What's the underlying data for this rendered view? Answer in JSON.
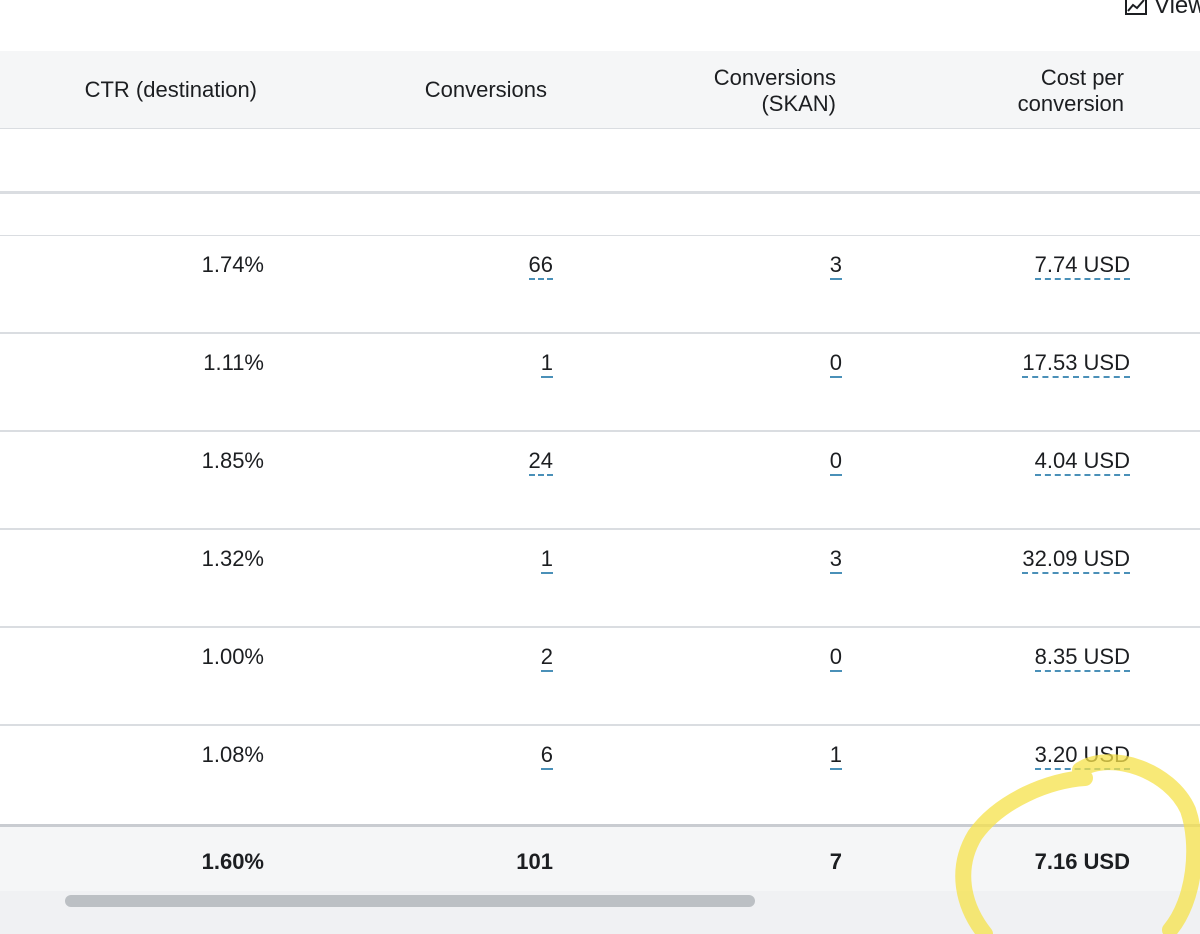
{
  "top": {
    "view_label": "View"
  },
  "headers": {
    "ctr": "CTR (destination)",
    "conversions": "Conversions",
    "skan_line1": "Conversions",
    "skan_line2": "(SKAN)",
    "cost_line1": "Cost per",
    "cost_line2": "conversion"
  },
  "rows": [
    {
      "ctr": "1.74%",
      "conversions": "66",
      "skan": "3",
      "cost": "7.74 USD"
    },
    {
      "ctr": "1.11%",
      "conversions": "1",
      "skan": "0",
      "cost": "17.53 USD"
    },
    {
      "ctr": "1.85%",
      "conversions": "24",
      "skan": "0",
      "cost": "4.04 USD"
    },
    {
      "ctr": "1.32%",
      "conversions": "1",
      "skan": "3",
      "cost": "32.09 USD"
    },
    {
      "ctr": "1.00%",
      "conversions": "2",
      "skan": "0",
      "cost": "8.35 USD"
    },
    {
      "ctr": "1.08%",
      "conversions": "6",
      "skan": "1",
      "cost": "3.20 USD"
    }
  ],
  "summary": {
    "ctr": "1.60%",
    "conversions": "101",
    "skan": "7",
    "cost": "7.16 USD"
  },
  "colors": {
    "highlight": "#f5e14a",
    "header_bg": "#f5f6f7",
    "dotted_underline": "#4a90b8"
  },
  "icons": {
    "view": "chart-view-icon"
  }
}
